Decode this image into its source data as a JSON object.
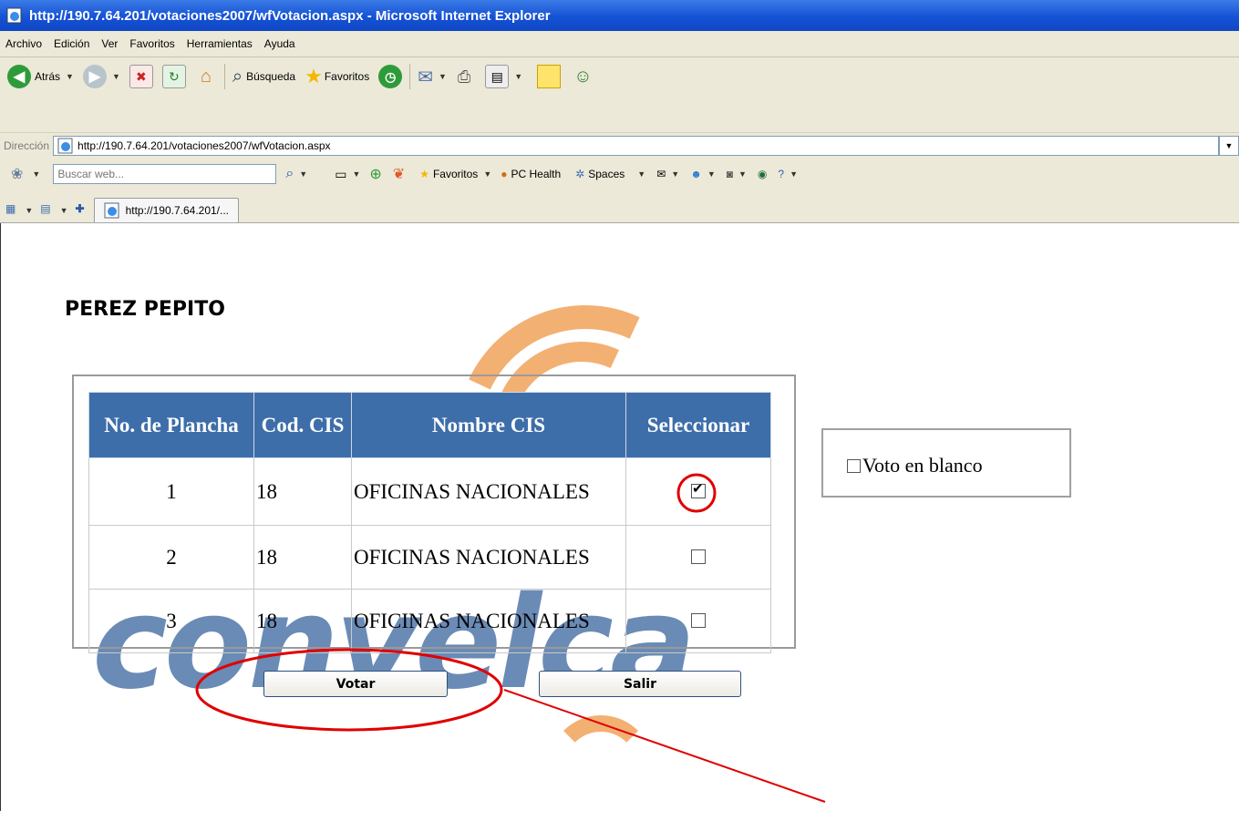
{
  "window": {
    "title": "http://190.7.64.201/votaciones2007/wfVotacion.aspx - Microsoft Internet Explorer"
  },
  "menu": [
    "Archivo",
    "Edición",
    "Ver",
    "Favoritos",
    "Herramientas",
    "Ayuda"
  ],
  "toolbar": {
    "back": "Atrás",
    "search": "Búsqueda",
    "favorites": "Favoritos"
  },
  "address": {
    "label": "Dirección",
    "url": "http://190.7.64.201/votaciones2007/wfVotacion.aspx"
  },
  "searchbar": {
    "placeholder": "Buscar web...",
    "favorites": "Favoritos",
    "pc_health": "PC Health",
    "spaces": "Spaces"
  },
  "tab": {
    "title": "http://190.7.64.201/..."
  },
  "page": {
    "heading": "PEREZ PEPITO",
    "watermark": "convelca",
    "table": {
      "headers": [
        "No. de Plancha",
        "Cod. CIS",
        "Nombre CIS",
        "Seleccionar"
      ],
      "rows": [
        {
          "no": "1",
          "cod": "18",
          "name": "OFICINAS NACIONALES",
          "selected": true
        },
        {
          "no": "2",
          "cod": "18",
          "name": "OFICINAS NACIONALES",
          "selected": false
        },
        {
          "no": "3",
          "cod": "18",
          "name": "OFICINAS NACIONALES",
          "selected": false
        }
      ]
    },
    "blank_vote": {
      "label": "Voto en blanco",
      "checked": false
    },
    "buttons": {
      "vote": "Votar",
      "exit": "Salir"
    }
  },
  "colors": {
    "table_header": "#3d6eaa",
    "annotation": "#e00000",
    "title_bar": "#1552d6",
    "chrome": "#ece9d8"
  },
  "icons": [
    "ie-page-icon",
    "back-icon",
    "forward-icon",
    "stop-icon",
    "refresh-icon",
    "home-icon",
    "search-icon",
    "favorites-star-icon",
    "history-icon",
    "mail-icon",
    "print-icon",
    "edit-icon",
    "note-icon",
    "messenger-icon"
  ]
}
